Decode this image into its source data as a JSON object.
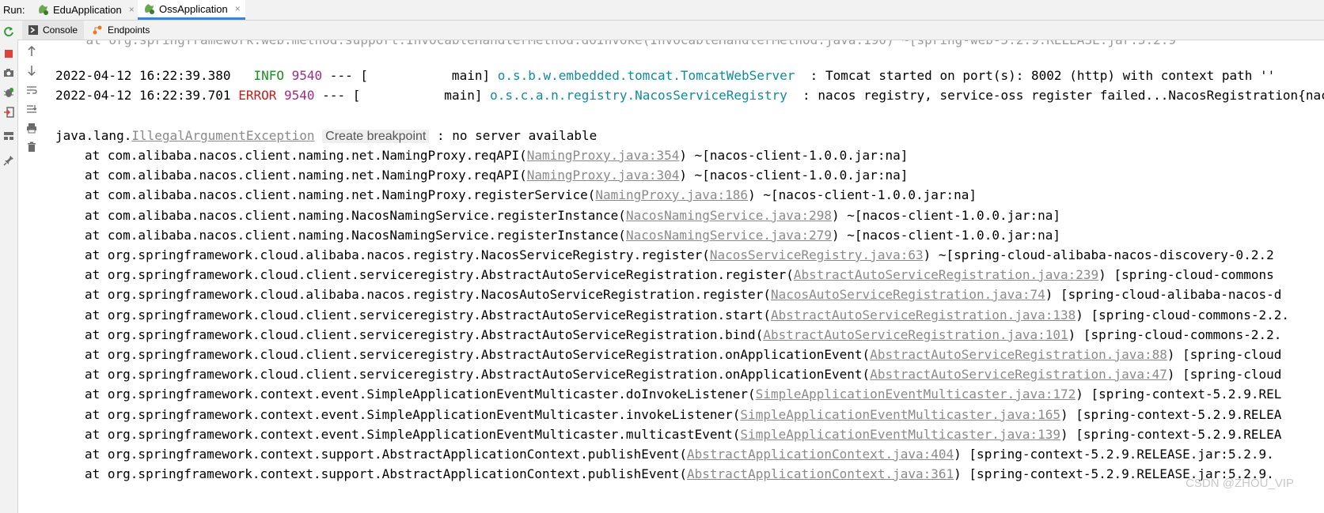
{
  "run_bar": {
    "label": "Run:",
    "tabs": [
      {
        "label": "EduApplication",
        "active": false
      },
      {
        "label": "OssApplication",
        "active": true
      }
    ],
    "close_glyph": "×"
  },
  "sub_tabs": [
    {
      "label": "Console",
      "icon": "console-icon",
      "active": true
    },
    {
      "label": "Endpoints",
      "icon": "endpoints-icon",
      "active": false
    }
  ],
  "left_toolbar_icons": [
    "rerun-icon",
    "stop-icon",
    "camera-icon",
    "debug-icon",
    "exit-icon",
    "layout-icon",
    "pin-icon"
  ],
  "console_toolbar_icons": [
    "scroll-up-icon",
    "scroll-down-icon",
    "soft-wrap-icon",
    "scroll-to-end-icon",
    "print-icon",
    "clear-icon"
  ],
  "colors": {
    "info": "#1e8c1e",
    "error": "#c81e1e",
    "pid": "#9c2c8c",
    "logger": "#118a9a",
    "accent": "#4083c9"
  },
  "console": {
    "clipped_top_line": "    at org.springframework.web.method.support.InvocableHandlerMethod.doInvoke(InvocableHandlerMethod.java:190) ~[spring-web-5.2.9.RELEASE.jar:5.2.9",
    "log_lines": [
      {
        "timestamp": "2022-04-12 16:22:39.380",
        "level": " INFO",
        "pid": "9540",
        "sep": " --- [           main] ",
        "logger": "o.s.b.w.embedded.tomcat.TomcatWebServer ",
        "message": " : Tomcat started on port(s): 8002 (http) with context path ''"
      },
      {
        "timestamp": "2022-04-12 16:22:39.701",
        "level": "ERROR",
        "pid": "9540",
        "sep": " --- [           main] ",
        "logger": "o.s.c.a.n.registry.NacosServiceRegistry ",
        "message": " : nacos registry, service-oss register failed...NacosRegistration{nacosDiscove"
      }
    ],
    "exception": {
      "prefix": "java.lang.",
      "class_name": "IllegalArgumentException",
      "hint": "Create breakpoint",
      "message": " : no server available"
    },
    "stack": [
      {
        "method": "at com.alibaba.nacos.client.naming.net.NamingProxy.reqAPI(",
        "link": "NamingProxy.java:354",
        "suffix": ") ~[nacos-client-1.0.0.jar:na]"
      },
      {
        "method": "at com.alibaba.nacos.client.naming.net.NamingProxy.reqAPI(",
        "link": "NamingProxy.java:304",
        "suffix": ") ~[nacos-client-1.0.0.jar:na]"
      },
      {
        "method": "at com.alibaba.nacos.client.naming.net.NamingProxy.registerService(",
        "link": "NamingProxy.java:186",
        "suffix": ") ~[nacos-client-1.0.0.jar:na]"
      },
      {
        "method": "at com.alibaba.nacos.client.naming.NacosNamingService.registerInstance(",
        "link": "NacosNamingService.java:298",
        "suffix": ") ~[nacos-client-1.0.0.jar:na]"
      },
      {
        "method": "at com.alibaba.nacos.client.naming.NacosNamingService.registerInstance(",
        "link": "NacosNamingService.java:279",
        "suffix": ") ~[nacos-client-1.0.0.jar:na]"
      },
      {
        "method": "at org.springframework.cloud.alibaba.nacos.registry.NacosServiceRegistry.register(",
        "link": "NacosServiceRegistry.java:63",
        "suffix": ") ~[spring-cloud-alibaba-nacos-discovery-0.2.2"
      },
      {
        "method": "at org.springframework.cloud.client.serviceregistry.AbstractAutoServiceRegistration.register(",
        "link": "AbstractAutoServiceRegistration.java:239",
        "suffix": ") [spring-cloud-commons"
      },
      {
        "method": "at org.springframework.cloud.alibaba.nacos.registry.NacosAutoServiceRegistration.register(",
        "link": "NacosAutoServiceRegistration.java:74",
        "suffix": ") [spring-cloud-alibaba-nacos-d"
      },
      {
        "method": "at org.springframework.cloud.client.serviceregistry.AbstractAutoServiceRegistration.start(",
        "link": "AbstractAutoServiceRegistration.java:138",
        "suffix": ") [spring-cloud-commons-2.2."
      },
      {
        "method": "at org.springframework.cloud.client.serviceregistry.AbstractAutoServiceRegistration.bind(",
        "link": "AbstractAutoServiceRegistration.java:101",
        "suffix": ") [spring-cloud-commons-2.2."
      },
      {
        "method": "at org.springframework.cloud.client.serviceregistry.AbstractAutoServiceRegistration.onApplicationEvent(",
        "link": "AbstractAutoServiceRegistration.java:88",
        "suffix": ") [spring-cloud"
      },
      {
        "method": "at org.springframework.cloud.client.serviceregistry.AbstractAutoServiceRegistration.onApplicationEvent(",
        "link": "AbstractAutoServiceRegistration.java:47",
        "suffix": ") [spring-cloud"
      },
      {
        "method": "at org.springframework.context.event.SimpleApplicationEventMulticaster.doInvokeListener(",
        "link": "SimpleApplicationEventMulticaster.java:172",
        "suffix": ") [spring-context-5.2.9.REL"
      },
      {
        "method": "at org.springframework.context.event.SimpleApplicationEventMulticaster.invokeListener(",
        "link": "SimpleApplicationEventMulticaster.java:165",
        "suffix": ") [spring-context-5.2.9.RELEA"
      },
      {
        "method": "at org.springframework.context.event.SimpleApplicationEventMulticaster.multicastEvent(",
        "link": "SimpleApplicationEventMulticaster.java:139",
        "suffix": ") [spring-context-5.2.9.RELEA"
      },
      {
        "method": "at org.springframework.context.support.AbstractApplicationContext.publishEvent(",
        "link": "AbstractApplicationContext.java:404",
        "suffix": ") [spring-context-5.2.9.RELEASE.jar:5.2.9."
      },
      {
        "method": "at org.springframework.context.support.AbstractApplicationContext.publishEvent(",
        "link": "AbstractApplicationContext.java:361",
        "suffix": ") [spring-context-5.2.9.RELEASE.jar:5.2.9."
      }
    ]
  },
  "watermark": "CSDN @ZHOU_VIP"
}
